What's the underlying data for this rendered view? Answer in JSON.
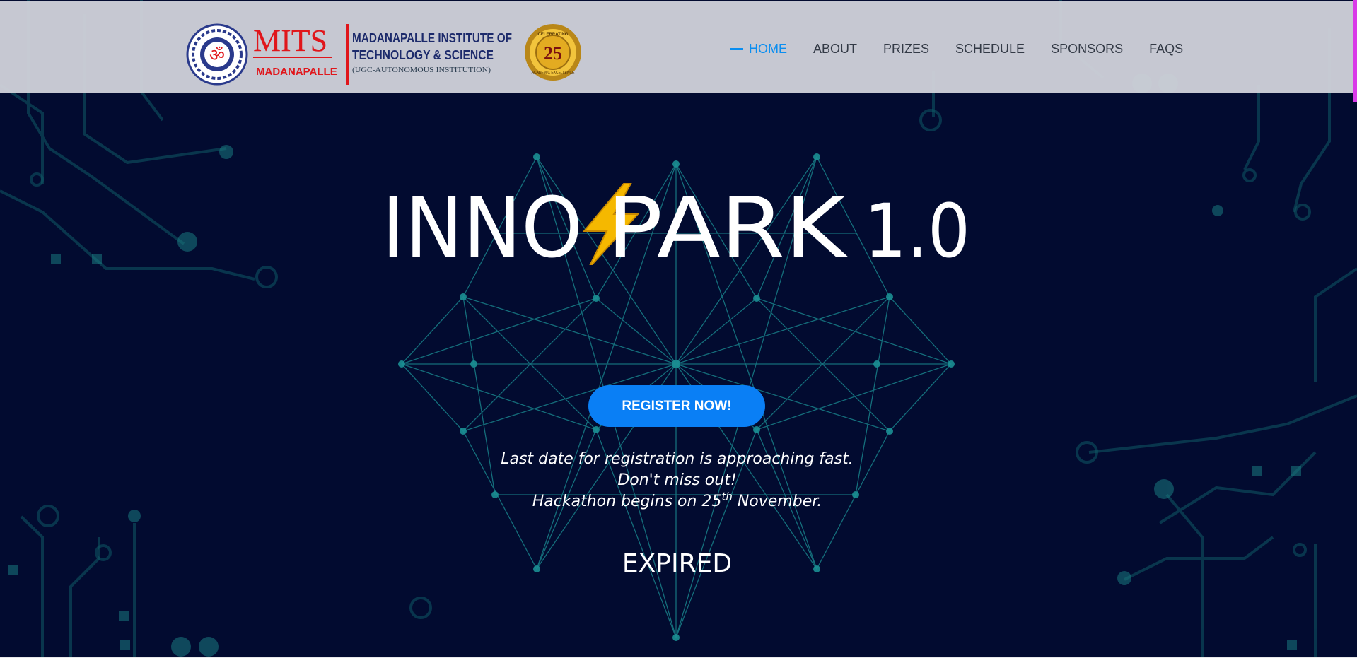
{
  "header": {
    "logo": {
      "brand": "MITS",
      "brand_sub": "MADANAPALLE",
      "institute_line1": "MADANAPALLE INSTITUTE OF",
      "institute_line2": "TECHNOLOGY & SCIENCE",
      "institute_line3": "(UGC-AUTONOMOUS INSTITUTION)",
      "badge_top": "CELEBRATING",
      "badge_number": "25",
      "badge_bottom": "ACADEMIC EXCELLENCE"
    },
    "nav": [
      {
        "label": "HOME",
        "active": true
      },
      {
        "label": "ABOUT",
        "active": false
      },
      {
        "label": "PRIZES",
        "active": false
      },
      {
        "label": "SCHEDULE",
        "active": false
      },
      {
        "label": "SPONSORS",
        "active": false
      },
      {
        "label": "FAQS",
        "active": false
      }
    ]
  },
  "hero": {
    "title_left": "INNO",
    "title_right": "PARK",
    "title_version": "1.0",
    "register_label": "REGISTER NOW!",
    "notice_line1": "Last date for registration is approaching fast.",
    "notice_line2": "Don't miss out!",
    "notice_line3_pre": "Hackathon begins on 25",
    "notice_line3_sup": "th",
    "notice_line3_post": " November.",
    "countdown_status": "EXPIRED"
  },
  "colors": {
    "background": "#020b30",
    "header_bg": "#ced0d8",
    "accent_blue": "#0a7ff5",
    "nav_active": "#0a8ef0",
    "circuit": "#17a3a0",
    "brand_red": "#e0161b",
    "brand_navy": "#1c2a6b",
    "bolt_yellow": "#f5b800"
  },
  "icons": {
    "bolt": "lightning-bolt-icon",
    "emblem": "mits-emblem-icon",
    "badge": "25-years-badge-icon"
  }
}
